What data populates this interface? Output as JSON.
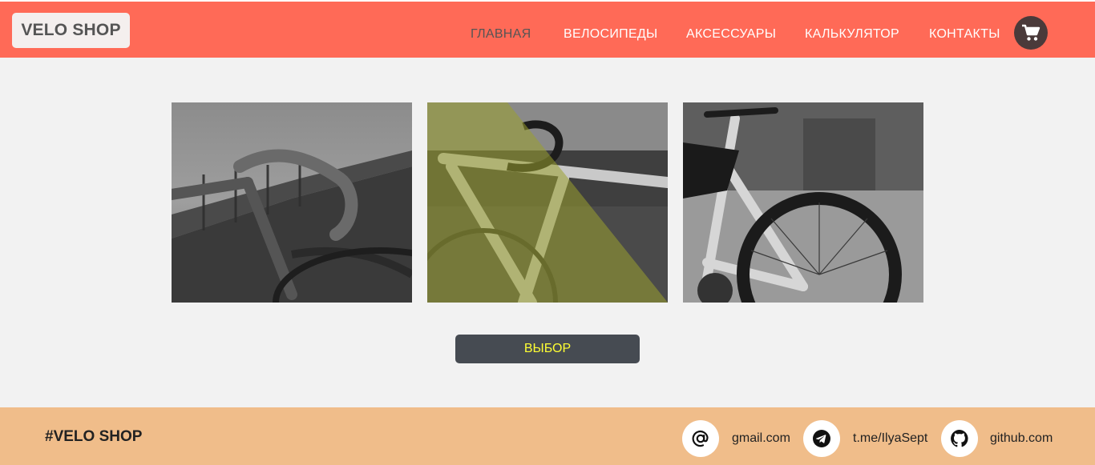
{
  "header": {
    "logo": "VELO SHOP",
    "nav": [
      {
        "label": "ГЛАВНАЯ",
        "active": true
      },
      {
        "label": "ВЕЛОСИПЕДЫ",
        "active": false
      },
      {
        "label": "АКСЕССУАРЫ",
        "active": false
      },
      {
        "label": "КАЛЬКУЛЯТОР",
        "active": false
      },
      {
        "label": "КОНТАКТЫ",
        "active": false
      }
    ],
    "cart_icon": "shopping-cart-icon"
  },
  "main": {
    "choose_button": "ВЫБОР"
  },
  "footer": {
    "brand": "#VELO SHOP",
    "contacts": [
      {
        "icon": "at-sign-icon",
        "text": "gmail.com"
      },
      {
        "icon": "telegram-icon",
        "text": "t.me/IlyaSept"
      },
      {
        "icon": "github-icon",
        "text": "github.com"
      }
    ]
  },
  "colors": {
    "header_bg": "#ff6a57",
    "footer_bg": "#f0bd8a",
    "button_bg": "#464b52",
    "button_text": "#ffff33",
    "page_bg": "#f2f2f2"
  }
}
